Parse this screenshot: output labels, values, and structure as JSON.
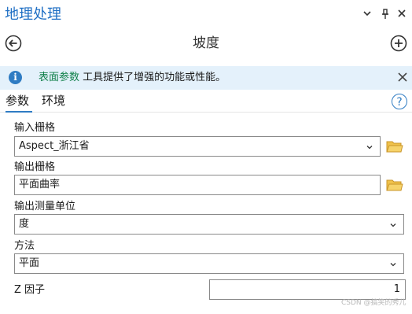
{
  "pane": {
    "title": "地理处理",
    "menu_icon": "chevron-down-icon",
    "pin_icon": "pin-icon",
    "close_icon": "close-icon"
  },
  "tool": {
    "title": "坡度",
    "back_icon": "back-arrow-icon",
    "add_icon": "add-icon"
  },
  "banner": {
    "link_text": "表面参数",
    "message": " 工具提供了增强的功能或性能。",
    "info_icon": "info-icon",
    "close_icon": "close-icon",
    "background": "#e4f1fb"
  },
  "tabs": [
    {
      "label": "参数",
      "active": true
    },
    {
      "label": "环境",
      "active": false
    }
  ],
  "help_icon": "help-icon",
  "form": {
    "input_raster": {
      "label": "输入栅格",
      "value": "Aspect_浙江省"
    },
    "output_raster": {
      "label": "输出栅格",
      "value": "平面曲率"
    },
    "output_unit": {
      "label": "输出测量单位",
      "value": "度"
    },
    "method": {
      "label": "方法",
      "value": "平面"
    },
    "z_factor": {
      "label": "Z 因子",
      "value": "1"
    }
  },
  "watermark": "CSDN @搞笑的秀儿",
  "colors": {
    "accent": "#2f7cc3",
    "title": "#1f6fc4",
    "link": "#11804a",
    "folder": "#e8b33a"
  }
}
